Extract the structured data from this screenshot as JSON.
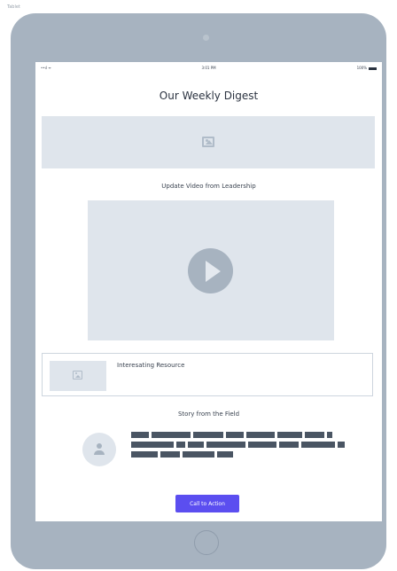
{
  "frame": {
    "label": "Tablet"
  },
  "status_bar": {
    "signal": "••ıl ᯤ",
    "time": "3:01 PM",
    "battery": "100%"
  },
  "digest": {
    "title": "Our Weekly Digest",
    "video_heading": "Update Video from Leadership",
    "resource_title": "Interesating Resource",
    "story_heading": "Story from the Field",
    "cta_label": "Call to Action"
  },
  "icons": {
    "hero": "image-icon",
    "resource": "image-icon",
    "video": "play-icon",
    "avatar": "person-icon",
    "home": "home-button-icon"
  },
  "colors": {
    "accent": "#5b4ef0",
    "placeholder": "#dfe5ec",
    "tablet_frame": "#a7b3c0",
    "redacted_text": "#4a5563"
  }
}
